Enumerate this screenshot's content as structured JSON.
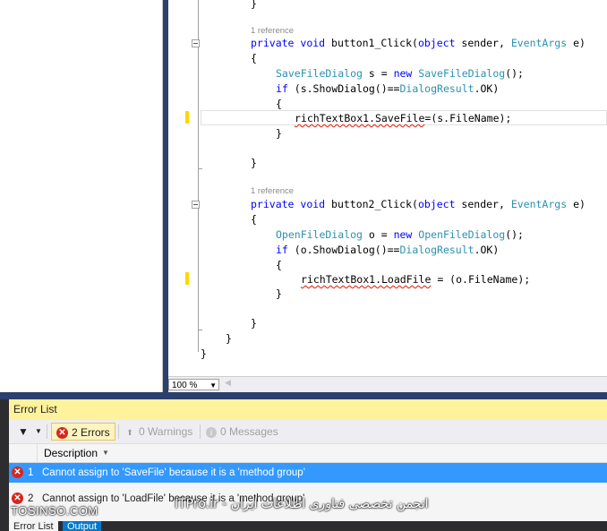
{
  "editor": {
    "lines": [
      {
        "kind": "code",
        "text": "}"
      },
      {
        "kind": "ref",
        "text": "1 reference"
      },
      {
        "kind": "code",
        "parts": [
          [
            "kw",
            "private "
          ],
          [
            "kw",
            "void "
          ],
          [
            "",
            "button1_Click("
          ],
          [
            "kw",
            "object "
          ],
          [
            "",
            "sender, "
          ],
          [
            "ty",
            "EventArgs "
          ],
          [
            "",
            "e)"
          ]
        ]
      },
      {
        "kind": "code",
        "text": "{"
      },
      {
        "kind": "code",
        "parts": [
          [
            "ty",
            "SaveFileDialog "
          ],
          [
            "",
            "s = "
          ],
          [
            "kw",
            "new "
          ],
          [
            "ty",
            "SaveFileDialog"
          ],
          [
            "",
            "();"
          ]
        ]
      },
      {
        "kind": "code",
        "parts": [
          [
            "kw",
            "if "
          ],
          [
            "",
            "(s.ShowDialog()=="
          ],
          [
            "ty",
            "DialogResult"
          ],
          [
            "",
            ".OK)"
          ]
        ]
      },
      {
        "kind": "code",
        "text": "{"
      },
      {
        "kind": "code",
        "parts": [
          [
            "sq",
            "richTextBox1.SaveFile"
          ],
          [
            "",
            "=(s.FileName);"
          ]
        ]
      },
      {
        "kind": "code",
        "text": "}"
      },
      {
        "kind": "code",
        "text": "}"
      },
      {
        "kind": "ref",
        "text": "1 reference"
      },
      {
        "kind": "code",
        "parts": [
          [
            "kw",
            "private "
          ],
          [
            "kw",
            "void "
          ],
          [
            "",
            "button2_Click("
          ],
          [
            "kw",
            "object "
          ],
          [
            "",
            "sender, "
          ],
          [
            "ty",
            "EventArgs "
          ],
          [
            "",
            "e)"
          ]
        ]
      },
      {
        "kind": "code",
        "text": "{"
      },
      {
        "kind": "code",
        "parts": [
          [
            "ty",
            "OpenFileDialog "
          ],
          [
            "",
            "o = "
          ],
          [
            "kw",
            "new "
          ],
          [
            "ty",
            "OpenFileDialog"
          ],
          [
            "",
            "();"
          ]
        ]
      },
      {
        "kind": "code",
        "parts": [
          [
            "kw",
            "if "
          ],
          [
            "",
            "(o.ShowDialog()=="
          ],
          [
            "ty",
            "DialogResult"
          ],
          [
            "",
            ".OK)"
          ]
        ]
      },
      {
        "kind": "code",
        "text": "{"
      },
      {
        "kind": "code",
        "parts": [
          [
            "sq",
            "richTextBox1.LoadFile"
          ],
          [
            "",
            " = (o.FileName);"
          ]
        ]
      },
      {
        "kind": "code",
        "text": "}"
      },
      {
        "kind": "code",
        "text": "}"
      },
      {
        "kind": "code",
        "text": "}"
      },
      {
        "kind": "code",
        "text": "}"
      }
    ],
    "zoom": "100 %"
  },
  "error_list": {
    "title": "Error List",
    "errors_label": "2 Errors",
    "warnings_label": "0 Warnings",
    "messages_label": "0 Messages",
    "column_description": "Description",
    "rows": [
      {
        "num": "1",
        "description": "Cannot assign to 'SaveFile' because it is a 'method group'",
        "selected": true
      },
      {
        "num": "2",
        "description": "Cannot assign to 'LoadFile' because it is a 'method group'",
        "selected": false
      }
    ]
  },
  "bottom_tabs": [
    {
      "label": "Error List",
      "active": true
    },
    {
      "label": "Output",
      "active": false
    }
  ],
  "watermarks": {
    "left": "TOSINSO.COM",
    "right": "ITPro.ir - انجمن تخصصی فناوری اطلاعات ایران"
  },
  "colors": {
    "keyword": "#0000ff",
    "type": "#2b91af",
    "error": "#d9251d",
    "selection": "#3399ff",
    "error_title_bg": "#fff29d",
    "chrome": "#2d3f6b"
  }
}
